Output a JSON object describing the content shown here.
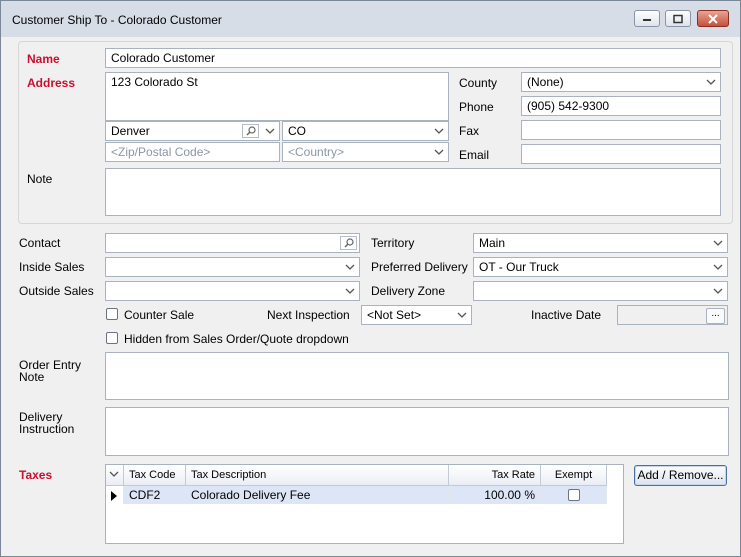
{
  "window": {
    "title": "Customer Ship To - Colorado Customer"
  },
  "address_panel": {
    "name_label": "Name",
    "name_value": "Colorado Customer",
    "address_label": "Address",
    "street_value": "123 Colorado St",
    "city_value": "Denver",
    "state_value": "CO",
    "zip_placeholder": "<Zip/Postal Code>",
    "country_placeholder": "<Country>",
    "county_label": "County",
    "county_value": "(None)",
    "phone_label": "Phone",
    "phone_value": "(905) 542-9300",
    "fax_label": "Fax",
    "fax_value": "",
    "email_label": "Email",
    "email_value": "",
    "note_label": "Note",
    "note_value": ""
  },
  "details": {
    "contact_label": "Contact",
    "contact_value": "",
    "inside_sales_label": "Inside Sales",
    "inside_sales_value": "",
    "outside_sales_label": "Outside Sales",
    "outside_sales_value": "",
    "territory_label": "Territory",
    "territory_value": "Main",
    "preferred_delivery_label": "Preferred Delivery",
    "preferred_delivery_value": "OT - Our Truck",
    "delivery_zone_label": "Delivery Zone",
    "delivery_zone_value": "",
    "counter_sale_label": "Counter Sale",
    "counter_sale_checked": false,
    "next_inspection_label": "Next Inspection",
    "next_inspection_value": "<Not Set>",
    "inactive_date_label": "Inactive Date",
    "inactive_date_value": "",
    "ellipsis_label": "...",
    "hidden_label": "Hidden from Sales Order/Quote dropdown",
    "hidden_checked": false,
    "order_entry_note_label_1": "Order Entry",
    "order_entry_note_label_2": "Note",
    "delivery_instruction_label_1": "Delivery",
    "delivery_instruction_label_2": "Instruction"
  },
  "taxes": {
    "label": "Taxes",
    "columns": [
      "Tax Code",
      "Tax Description",
      "Tax Rate",
      "Exempt"
    ],
    "rows": [
      {
        "code": "CDF2",
        "description": "Colorado Delivery Fee",
        "rate": "100.00 %",
        "exempt": false
      }
    ],
    "add_remove_label": "Add / Remove..."
  },
  "colors": {
    "required_label": "#c8102e",
    "selected_row": "#dde6f7"
  }
}
